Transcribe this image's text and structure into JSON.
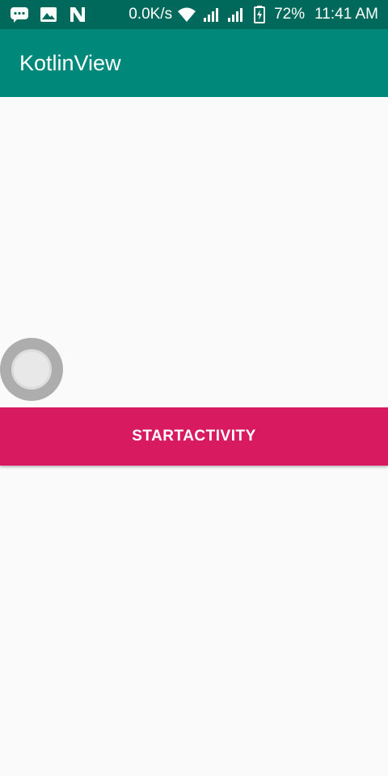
{
  "status_bar": {
    "icons_left": [
      "message-icon",
      "image-icon",
      "n-icon"
    ],
    "network_speed": "0.0K/s",
    "icons_right": [
      "wifi-icon",
      "signal-icon",
      "signal-icon",
      "battery-icon"
    ],
    "battery": "72%",
    "time": "11:41 AM"
  },
  "app_bar": {
    "title": "KotlinView",
    "color": "#00897b"
  },
  "main": {
    "start_button_label": "STARTACTIVITY",
    "start_button_color": "#d81b60"
  }
}
